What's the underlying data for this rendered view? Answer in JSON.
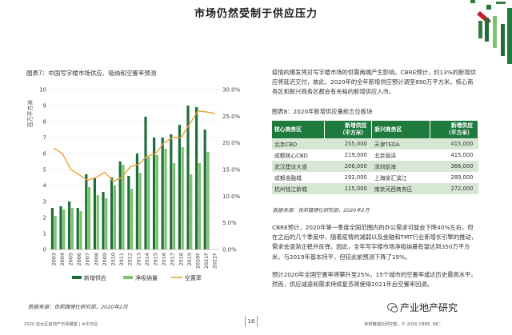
{
  "page": {
    "title": "市场仍然受制于供应压力",
    "page_number": "16",
    "footer_left": "2020 亚太区房地产市场展望 | 大中华区",
    "footer_right": "世邦魏理仕研究部。© 2020 CBRE, INC.",
    "watermark": "产业地产研究"
  },
  "figure7": {
    "caption": "图表7：中国写字楼市场供应、吸纳和空置率预测",
    "source": "数据来源：世邦魏理仕研究部，2020年2月"
  },
  "chart_data": {
    "type": "bar",
    "y_label": "百万平方米",
    "y2_label": "",
    "ylim": [
      0,
      10
    ],
    "y2lim": [
      0,
      30
    ],
    "y_ticks": [
      "0",
      "1",
      "2",
      "3",
      "4",
      "5",
      "6",
      "7",
      "8",
      "9",
      "10"
    ],
    "y2_ticks": [
      "0.0%",
      "5.0%",
      "10.0%",
      "15.0%",
      "20.0%",
      "25.0%",
      "30.0%"
    ],
    "categories": [
      "2003",
      "2004",
      "2005",
      "2006",
      "2007",
      "2008",
      "2009",
      "2010",
      "2011",
      "2012",
      "2013",
      "2014",
      "2015",
      "2016",
      "2017",
      "2018",
      "2019",
      "2020F",
      "2021F",
      "2022F"
    ],
    "series": [
      {
        "name": "新增供应",
        "kind": "bar",
        "color": "#1f6e3a",
        "values": [
          2.6,
          2.7,
          3.0,
          2.6,
          4.7,
          4.5,
          3.6,
          4.5,
          5.5,
          4.6,
          6.0,
          8.3,
          7.0,
          7.0,
          7.2,
          7.8,
          9.0,
          8.9,
          7.5,
          0
        ]
      },
      {
        "name": "净吸纳量",
        "kind": "bar",
        "color": "#7cc36b",
        "values": [
          2.1,
          2.5,
          2.6,
          2.4,
          3.9,
          3.4,
          3.2,
          4.0,
          5.3,
          3.8,
          4.8,
          5.8,
          5.9,
          6.3,
          5.4,
          6.4,
          4.7,
          5.4,
          6.1,
          0
        ]
      },
      {
        "name": "空置率",
        "kind": "line",
        "color": "#e8a33a",
        "values": [
          19.0,
          18.0,
          15.0,
          14.0,
          13.0,
          13.5,
          14.5,
          12.8,
          13.5,
          15.5,
          16.0,
          17.5,
          18.0,
          20.0,
          21.0,
          21.0,
          23.5,
          26.0,
          25.8,
          25.5
        ]
      }
    ]
  },
  "right": {
    "para1": "疫情的爆发将对写字楼市场的供需两端产生影响。CBRE预计，约13%的新增供应将延迟交付，故此，2020年的全年新增供应预计调至890万平方米，核心商务区和新兴商务区都会有充裕的新增供应入市。",
    "table_caption": "图表8：2020年新增供应量前五位板块",
    "table_source": "数据来源：世邦魏理仕研究部，2020年2月",
    "headers": [
      "核心商务区",
      "新增供应\n（平方米）",
      "新兴商务区",
      "新增供应\n（平方米）"
    ],
    "rows": [
      [
        "北京CBD",
        "255,000",
        "天津TEDA",
        "415,000"
      ],
      [
        "成都核心CBD",
        "219,000",
        "北京丽泽",
        "415,000"
      ],
      [
        "武汉建设大道",
        "206,000",
        "深圳前海",
        "366,000"
      ],
      [
        "成都金融城",
        "192,000",
        "上海徐汇滨江",
        "289,000"
      ],
      [
        "杭州钱江新城",
        "115,000",
        "南京河西商务区",
        "272,000"
      ]
    ],
    "para2": "CBRE预计，2020年第一季度全国范围内的办公需求可能会下降40%左右，但在之后的几个季度中，随着疫情的减弱以及金融和TMT行业新增长引擎的推动，需求会逐渐企稳并反弹。因此，全年写字楼市场净吸纳量有望达到350万平方米，与2019年基本持平，但较此前预测下降了19%。",
    "para3": "预计2020年全国空置率将攀升至25%，15个城市的空置率或达历史最高水平。然而，供应减速和需求持续复苏将使得2021年后空置率回调。"
  }
}
